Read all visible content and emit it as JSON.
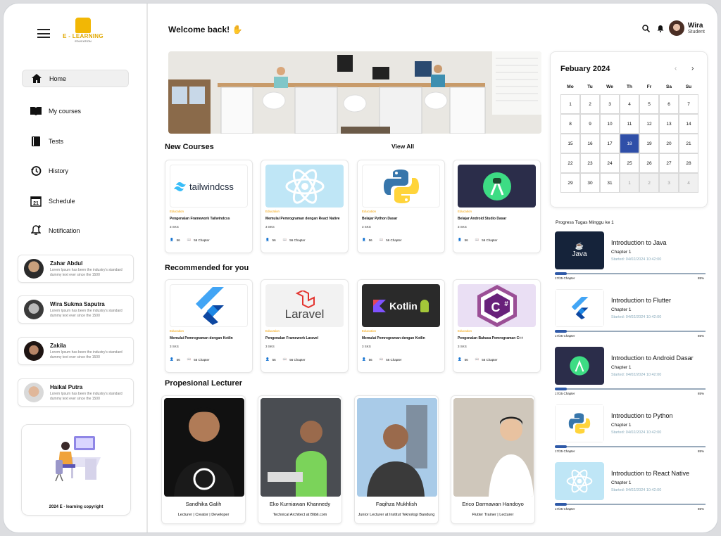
{
  "app": {
    "logo_title": "E - LEARNING",
    "logo_sub": "EDUCATION"
  },
  "sidebar": {
    "items": [
      {
        "label": "Home",
        "icon": "home-icon"
      },
      {
        "label": "My courses",
        "icon": "book-icon"
      },
      {
        "label": "Tests",
        "icon": "notebook-icon"
      },
      {
        "label": "History",
        "icon": "history-icon"
      },
      {
        "label": "Schedule",
        "icon": "calendar-icon"
      },
      {
        "label": "Notification",
        "icon": "bell-icon"
      }
    ],
    "users": [
      {
        "name": "Zahar Abdul",
        "desc": "Lorem Ipsum has been the industry's standard dummy text ever since the 1500"
      },
      {
        "name": "Wira Sukma Saputra",
        "desc": "Lorem Ipsum has been the industry's standard dummy text ever since the 1500"
      },
      {
        "name": "Zakila",
        "desc": "Lorem Ipsum has been the industry's standard dummy text ever since the 1500"
      },
      {
        "name": "Haikal Putra",
        "desc": "Lorem Ipsum has been the industry's standard dummy text ever since the 1500"
      }
    ],
    "copyright": "2024 E - learning copyright"
  },
  "header": {
    "welcome": "Welcome back!",
    "user_name": "Wira",
    "user_role": "Student"
  },
  "new_courses": {
    "title": "New Courses",
    "view_all": "View All",
    "items": [
      {
        "thumb": "tailwindcss",
        "category": "Education",
        "title": "Pengenalan Framework Tailwindcss",
        "sks": "3 SKS",
        "students": "56",
        "chapters": "56 Chapter"
      },
      {
        "thumb": "react",
        "category": "Education",
        "title": "Memulai Pemrograman dengan React Native",
        "sks": "3 SKS",
        "students": "56",
        "chapters": "56 Chapter"
      },
      {
        "thumb": "python",
        "category": "Education",
        "title": "Belajar Python Dasar",
        "sks": "3 SKS",
        "students": "56",
        "chapters": "56 Chapter"
      },
      {
        "thumb": "android",
        "category": "Education",
        "title": "Belajar Android Studio Dasar",
        "sks": "3 SKS",
        "students": "56",
        "chapters": "56 Chapter"
      }
    ]
  },
  "recommended": {
    "title": "Recommended for you",
    "items": [
      {
        "thumb": "flutter",
        "category": "Education",
        "title": "Memulai Pemrograman dengan Kotlin",
        "sks": "3 SKS",
        "students": "56",
        "chapters": "56 Chapter"
      },
      {
        "thumb": "Laravel",
        "category": "Education",
        "title": "Pengenalan Framework Laravel",
        "sks": "3 SKS",
        "students": "56",
        "chapters": "56 Chapter"
      },
      {
        "thumb": "Kotlin",
        "category": "Education",
        "title": "Memulai Pemrograman dengan Kotlin",
        "sks": "3 SKS",
        "students": "56",
        "chapters": "56 Chapter"
      },
      {
        "thumb": "C#",
        "category": "Education",
        "title": "Pengenalan Bahasa Pemrograman C++",
        "sks": "3 SKS",
        "students": "56",
        "chapters": "56 Chapter"
      }
    ]
  },
  "lecturers": {
    "title": "Propesional Lecturer",
    "items": [
      {
        "name": "Sandhika Galih",
        "role": "Lecturer | Creator | Developer"
      },
      {
        "name": "Eko Kurniawan Khannedy",
        "role": "Technical Architect at Blibli.com"
      },
      {
        "name": "Faqihza Mukhlish",
        "role": "Junior Lecturer at Institut Teknologi Bandung"
      },
      {
        "name": "Erico Darmawan Handoyo",
        "role": "Flutter Trainer | Lecturer"
      }
    ]
  },
  "calendar": {
    "month": "Febuary 2024",
    "prev": "‹",
    "next": "›",
    "days": [
      "Mo",
      "Tu",
      "We",
      "Th",
      "Fr",
      "Sa",
      "Su"
    ],
    "weeks": [
      [
        "1",
        "2",
        "3",
        "4",
        "5",
        "6",
        "7"
      ],
      [
        "8",
        "9",
        "10",
        "11",
        "12",
        "13",
        "14"
      ],
      [
        "15",
        "16",
        "17",
        "18",
        "19",
        "20",
        "21"
      ],
      [
        "22",
        "23",
        "24",
        "25",
        "26",
        "27",
        "28"
      ],
      [
        "29",
        "30",
        "31",
        "1",
        "2",
        "3",
        "4"
      ]
    ],
    "selected": "18"
  },
  "progress": {
    "title": "Progress Tugas Minggu ke 1",
    "items": [
      {
        "thumb": "Java",
        "name": "Introduction to Java",
        "chapter": "Chapter 1",
        "started": "Started: 04/02/2024 10:42:00",
        "count": "17/25 Chapter",
        "percent": "85%",
        "fill": 0.08
      },
      {
        "thumb": "flutter",
        "name": "Introduction to Flutter",
        "chapter": "Chapter 1",
        "started": "Started: 04/02/2024 10:42:00",
        "count": "17/25 Chapter",
        "percent": "85%",
        "fill": 0.08
      },
      {
        "thumb": "android",
        "name": "Introduction to Android Dasar",
        "chapter": "Chapter 1",
        "started": "Started: 04/02/2024 10:42:00",
        "count": "17/25 Chapter",
        "percent": "85%",
        "fill": 0.08
      },
      {
        "thumb": "python",
        "name": "Introduction to Python",
        "chapter": "Chapter 1",
        "started": "Started: 04/02/2024 10:42:00",
        "count": "17/25 Chapter",
        "percent": "85%",
        "fill": 0.08
      },
      {
        "thumb": "react",
        "name": "Introduction to React Native",
        "chapter": "Chapter 1",
        "started": "Started: 04/02/2024 10:42:00",
        "count": "17/25 Chapter",
        "percent": "85%",
        "fill": 0.08
      }
    ]
  }
}
